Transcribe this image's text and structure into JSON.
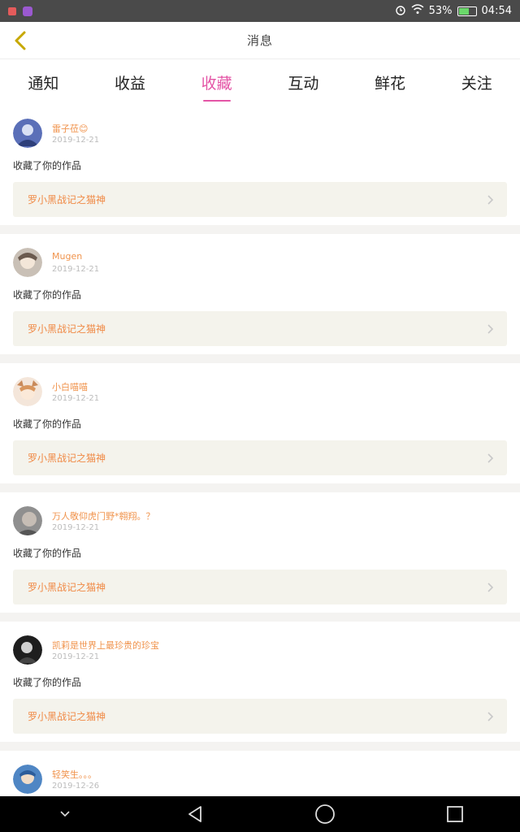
{
  "status_bar": {
    "battery": "53%",
    "time": "04:54",
    "icons": [
      "app-icon-red",
      "app-icon-purple",
      "alarm-icon",
      "wifi-icon",
      "battery-icon"
    ]
  },
  "header": {
    "title": "消息",
    "back_icon": "chevron-left-icon"
  },
  "tabs": [
    {
      "label": "通知",
      "active": false
    },
    {
      "label": "收益",
      "active": false
    },
    {
      "label": "收藏",
      "active": true
    },
    {
      "label": "互动",
      "active": false
    },
    {
      "label": "鲜花",
      "active": false
    },
    {
      "label": "关注",
      "active": false
    }
  ],
  "notifications": [
    {
      "user": "雷子莅😊",
      "date": "2019-12-21",
      "action": "收藏了你的作品",
      "work": "罗小黑战记之猫神",
      "avatar_color": "#5a6fb8"
    },
    {
      "user": "Mugen",
      "date": "2019-12-21",
      "action": "收藏了你的作品",
      "work": "罗小黑战记之猫神",
      "avatar_color": "#c9c0b6"
    },
    {
      "user": "小白喵喵",
      "date": "2019-12-21",
      "action": "收藏了你的作品",
      "work": "罗小黑战记之猫神",
      "avatar_color": "#e8c6a0"
    },
    {
      "user": "万人敬仰虎门野*翱翔。？",
      "date": "2019-12-21",
      "action": "收藏了你的作品",
      "work": "罗小黑战记之猫神",
      "avatar_color": "#9a9a9a"
    },
    {
      "user": "凯莉是世界上最珍贵的珍宝",
      "date": "2019-12-21",
      "action": "收藏了你的作品",
      "work": "罗小黑战记之猫神",
      "avatar_color": "#2a2a2a"
    },
    {
      "user": "轻笑生。。。",
      "date": "2019-12-26",
      "action": "",
      "work": "",
      "avatar_color": "#4f86c4"
    }
  ],
  "nav": [
    "chevron-down-icon",
    "back-triangle-icon",
    "home-circle-icon",
    "recents-square-icon"
  ],
  "colors": {
    "accent": "#e455a6",
    "username": "#f0934c",
    "work_title": "#f08a46"
  }
}
